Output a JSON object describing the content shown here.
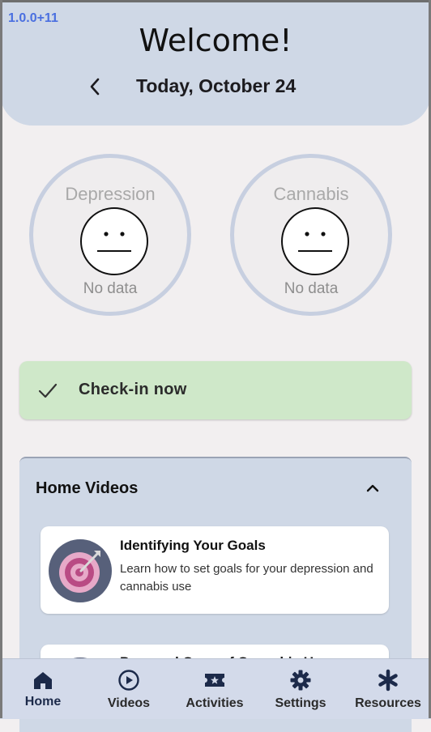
{
  "app": {
    "version": "1.0.0+11",
    "welcome": "Welcome!",
    "date": "Today, October 24"
  },
  "gauges": [
    {
      "title": "Depression",
      "status": "No data",
      "face_icon": "neutral-face-icon"
    },
    {
      "title": "Cannabis",
      "status": "No data",
      "face_icon": "neutral-face-icon"
    }
  ],
  "checkin": {
    "label": "Check-in now",
    "icon": "check-icon"
  },
  "videos": {
    "title": "Home Videos",
    "items": [
      {
        "title": "Identifying Your Goals",
        "description": "Learn how to set goals for your depression and cannabis use",
        "icon": "target-icon"
      },
      {
        "title": "Pros and Cons of Cannabis Use",
        "icon": "video-thumbnail-icon"
      }
    ]
  },
  "nav": [
    {
      "label": "Home",
      "icon": "home-icon"
    },
    {
      "label": "Videos",
      "icon": "play-circle-icon"
    },
    {
      "label": "Activities",
      "icon": "ticket-icon"
    },
    {
      "label": "Settings",
      "icon": "gear-icon"
    },
    {
      "label": "Resources",
      "icon": "asterisk-icon"
    }
  ],
  "colors": {
    "header_bg": "#cfd8e6",
    "checkin_bg": "#cfe8c9",
    "version_text": "#4a6fe0",
    "nav_bg": "#d3daea"
  }
}
